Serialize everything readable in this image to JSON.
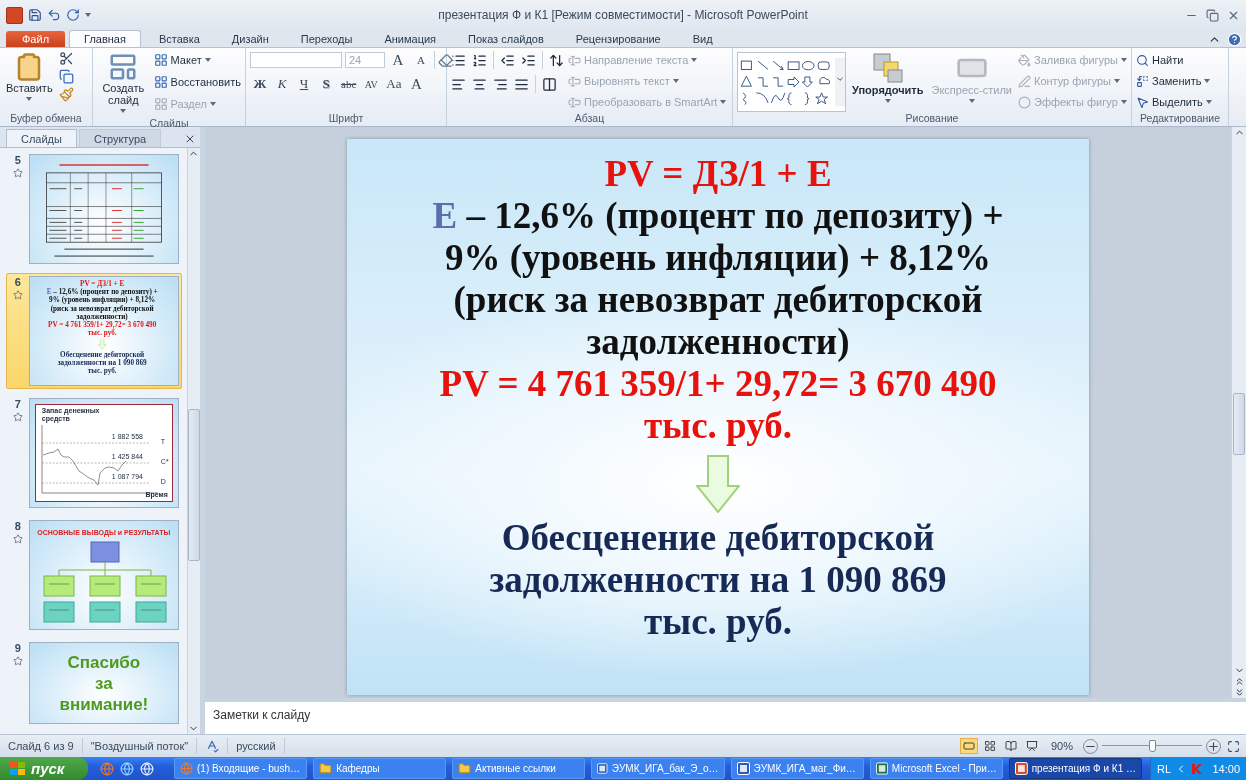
{
  "window": {
    "title": "презентация Ф и К1 [Режим совместимости] - Microsoft PowerPoint"
  },
  "ribbon_tabs": [
    {
      "label": "Файл",
      "kind": "file",
      "selected": false
    },
    {
      "label": "Главная",
      "kind": "tab",
      "selected": true
    },
    {
      "label": "Вставка",
      "kind": "tab",
      "selected": false
    },
    {
      "label": "Дизайн",
      "kind": "tab",
      "selected": false
    },
    {
      "label": "Переходы",
      "kind": "tab",
      "selected": false
    },
    {
      "label": "Анимация",
      "kind": "tab",
      "selected": false
    },
    {
      "label": "Показ слайдов",
      "kind": "tab",
      "selected": false
    },
    {
      "label": "Рецензирование",
      "kind": "tab",
      "selected": false
    },
    {
      "label": "Вид",
      "kind": "tab",
      "selected": false
    }
  ],
  "ribbon_groups": [
    {
      "kind": "clipboard",
      "title": "Буфер обмена",
      "paste": "Вставить"
    },
    {
      "kind": "slides",
      "title": "Слайды",
      "new_slide": "Создать слайд",
      "items": [
        {
          "label": "Макет",
          "menu": true,
          "disabled": false
        },
        {
          "label": "Восстановить",
          "menu": false,
          "disabled": false
        },
        {
          "label": "Раздел",
          "menu": true,
          "disabled": true
        }
      ]
    },
    {
      "kind": "font",
      "title": "Шрифт",
      "size": "24",
      "top_buttons": [
        {
          "glyph": "A",
          "kind": "grow"
        },
        {
          "glyph": "A",
          "kind": "shrink"
        }
      ],
      "format_buttons": [
        {
          "glyph": "Ж",
          "kind": "bold"
        },
        {
          "glyph": "К",
          "kind": "italic"
        },
        {
          "glyph": "Ч",
          "kind": "underline"
        },
        {
          "glyph": "S",
          "kind": "shadow"
        },
        {
          "glyph": "abc",
          "kind": "strike"
        },
        {
          "glyph": "AV",
          "kind": "spacing"
        },
        {
          "glyph": "Aa",
          "kind": "case"
        },
        {
          "glyph": "A",
          "kind": "color"
        }
      ]
    },
    {
      "kind": "paragraph",
      "title": "Абзац",
      "items": [
        {
          "label": "Направление текста",
          "menu": true,
          "disabled": true
        },
        {
          "label": "Выровнять текст",
          "menu": true,
          "disabled": true
        },
        {
          "label": "Преобразовать в SmartArt",
          "menu": true,
          "disabled": true
        }
      ]
    },
    {
      "kind": "drawing",
      "title": "Рисование",
      "arrange": "Упорядочить",
      "quick_styles": {
        "label": "Экспресс-стили",
        "disabled": true
      },
      "items": [
        {
          "label": "Заливка фигуры",
          "menu": true,
          "disabled": true
        },
        {
          "label": "Контур фигуры",
          "menu": true,
          "disabled": true
        },
        {
          "label": "Эффекты фигур",
          "menu": true,
          "disabled": true
        }
      ]
    },
    {
      "kind": "editing",
      "title": "Редактирование",
      "items": [
        {
          "label": "Найти",
          "menu": false,
          "disabled": false
        },
        {
          "label": "Заменить",
          "menu": true,
          "disabled": false
        },
        {
          "label": "Выделить",
          "menu": true,
          "disabled": false
        }
      ]
    }
  ],
  "panel_tabs": [
    {
      "label": "Слайды",
      "selected": true
    },
    {
      "label": "Структура",
      "selected": false
    }
  ],
  "thumbnails": [
    {
      "number": "5",
      "kind": "table",
      "selected": false
    },
    {
      "number": "6",
      "kind": "text",
      "selected": true,
      "slide": {
        "title": "PV = ДЗ/1 + Е",
        "term": "Е",
        "definition": "– 12,6% (процент по депозиту) + 9% (уровень инфляции) + 8,12% (риск за невозврат дебиторской задолженности)",
        "result": "PV = 4 761 359/1+ 29,72= 3 670 490 тыс. руб.",
        "conclusion": "Обесценение дебиторской задолженности на 1 090 869 тыс. руб."
      }
    },
    {
      "number": "7",
      "kind": "chart",
      "selected": false,
      "title": "Запас денежных средств",
      "values": [
        "1 882 558",
        "1 425 844",
        "1 087 794"
      ],
      "marks": [
        "T",
        "C*",
        "D"
      ],
      "axis": "Время"
    },
    {
      "number": "8",
      "kind": "diagram",
      "selected": false,
      "title": "ОСНОВНЫЕ ВЫВОДЫ и РЕЗУЛЬТАТЫ"
    },
    {
      "number": "9",
      "kind": "thanks",
      "selected": false,
      "lines": [
        "Спасибо",
        "за",
        "внимание!"
      ]
    }
  ],
  "slide": {
    "title": "PV = ДЗ/1 + Е",
    "term": "Е",
    "definition": "– 12,6% (процент по депозиту) + 9% (уровень инфляции) + 8,12% (риск за невозврат дебиторской задолженности)",
    "result": "PV = 4 761 359/1+ 29,72= 3 670 490 тыс. руб.",
    "conclusion": "Обесценение дебиторской задолженности на 1 090 869 тыс. руб."
  },
  "notes": {
    "placeholder": "Заметки к слайду"
  },
  "status_bar": {
    "slide_info": "Слайд 6 из 9",
    "theme": "\"Воздушный поток\"",
    "language": "русский",
    "views": [
      {
        "kind": "normal",
        "selected": true
      },
      {
        "kind": "sorter",
        "selected": false
      },
      {
        "kind": "reading",
        "selected": false
      },
      {
        "kind": "show",
        "selected": false
      }
    ],
    "zoom": "90%",
    "zoom_slider": {
      "level": 0.5
    }
  },
  "taskbar": {
    "start": "пуск",
    "tasks": [
      {
        "label": "(1) Входящие - bush…",
        "kind": "browser",
        "selected": false
      },
      {
        "label": "Кафедры",
        "kind": "folder",
        "selected": false
      },
      {
        "label": "Активные ссылки",
        "kind": "folder",
        "selected": false
      },
      {
        "label": "ЭУМК_ИГА_бак_Э_о…",
        "kind": "word",
        "selected": false
      },
      {
        "label": "ЭУМК_ИГА_маг_Фи…",
        "kind": "word",
        "selected": false
      },
      {
        "label": "Microsoft Excel - При…",
        "kind": "excel",
        "selected": false
      },
      {
        "label": "презентация Ф и К1 …",
        "kind": "powerpoint",
        "selected": true
      }
    ],
    "tray": {
      "language": "RL",
      "time": "14:00"
    }
  }
}
